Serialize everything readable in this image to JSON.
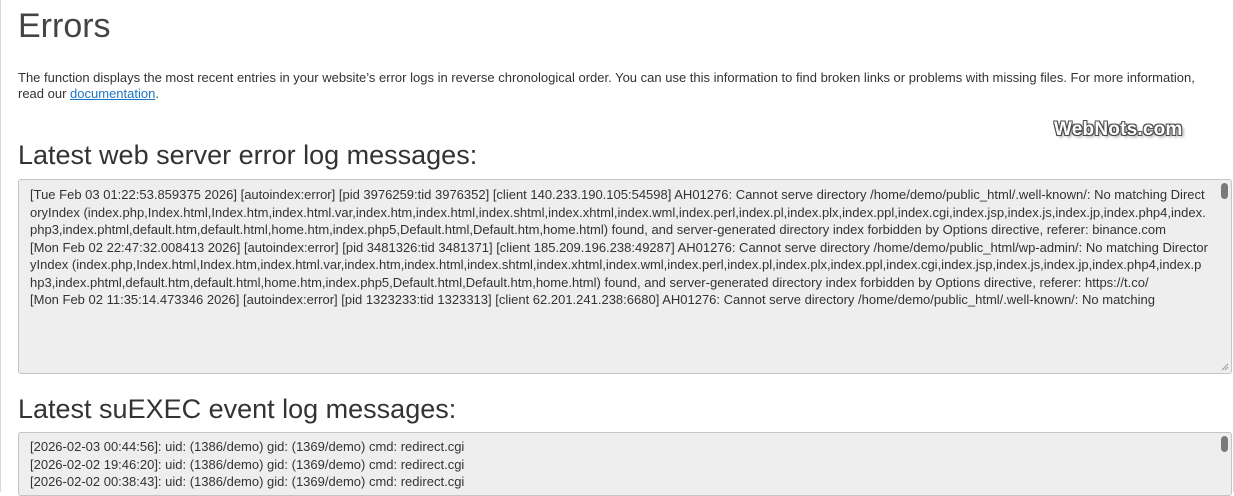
{
  "page": {
    "title": "Errors",
    "intro_text": "The function displays the most recent entries in your website’s error logs in reverse chronological order. You can use this information to find broken links or problems with missing files. For more information, read our ",
    "intro_link": "documentation",
    "intro_end": "."
  },
  "watermark": {
    "text": "WebNots.com"
  },
  "web_log": {
    "heading": "Latest web server error log messages:",
    "entries": [
      "[Tue Feb 03 01:22:53.859375 2026] [autoindex:error] [pid 3976259:tid 3976352] [client 140.233.190.105:54598] AH01276: Cannot serve directory /home/demo/public_html/.well-known/: No matching DirectoryIndex (index.php,Index.html,Index.htm,index.html.var,index.htm,index.html,index.shtml,index.xhtml,index.wml,index.perl,index.pl,index.plx,index.ppl,index.cgi,index.jsp,index.js,index.jp,index.php4,index.php3,index.phtml,default.htm,default.html,home.htm,index.php5,Default.html,Default.htm,home.html) found, and server-generated directory index forbidden by Options directive, referer: binance.com",
      "[Mon Feb 02 22:47:32.008413 2026] [autoindex:error] [pid 3481326:tid 3481371] [client 185.209.196.238:49287] AH01276: Cannot serve directory /home/demo/public_html/wp-admin/: No matching DirectoryIndex (index.php,Index.html,Index.htm,index.html.var,index.htm,index.html,index.shtml,index.xhtml,index.wml,index.perl,index.pl,index.plx,index.ppl,index.cgi,index.jsp,index.js,index.jp,index.php4,index.php3,index.phtml,default.htm,default.html,home.htm,index.php5,Default.html,Default.htm,home.html) found, and server-generated directory index forbidden by Options directive, referer: https://t.co/",
      "[Mon Feb 02 11:35:14.473346 2026] [autoindex:error] [pid 1323233:tid 1323313] [client 62.201.241.238:6680] AH01276: Cannot serve directory /home/demo/public_html/.well-known/: No matching"
    ]
  },
  "suexec_log": {
    "heading": "Latest suEXEC event log messages:",
    "entries": [
      "[2026-02-03 00:44:56]: uid: (1386/demo) gid: (1369/demo) cmd: redirect.cgi",
      "[2026-02-02 19:46:20]: uid: (1386/demo) gid: (1369/demo) cmd: redirect.cgi",
      "[2026-02-02 00:38:43]: uid: (1386/demo) gid: (1369/demo) cmd: redirect.cgi"
    ]
  }
}
